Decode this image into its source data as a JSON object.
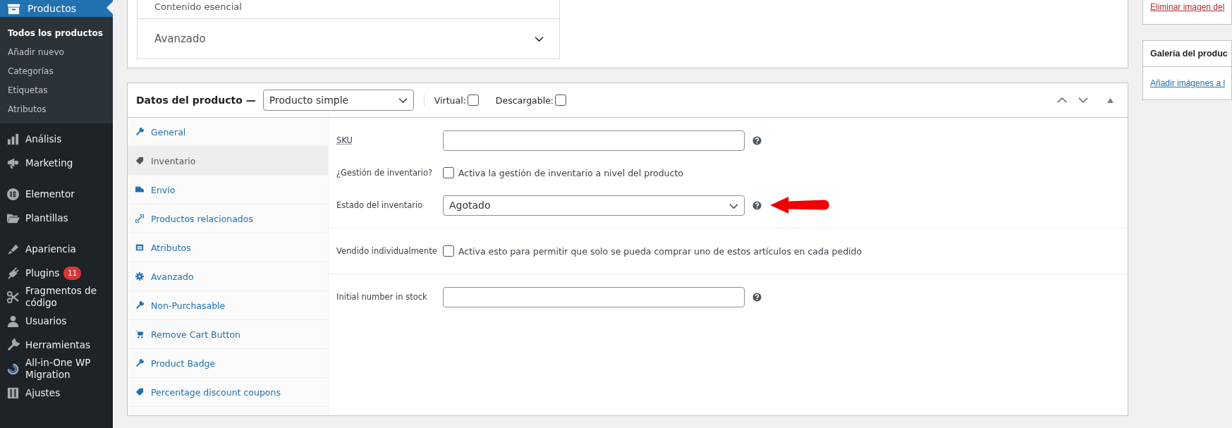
{
  "sidebar": {
    "current": {
      "label": "Productos",
      "submenu": [
        {
          "label": "Todos los productos",
          "selected": true
        },
        {
          "label": "Añadir nuevo",
          "selected": false
        },
        {
          "label": "Categorías",
          "selected": false
        },
        {
          "label": "Etiquetas",
          "selected": false
        },
        {
          "label": "Atributos",
          "selected": false
        }
      ]
    },
    "groups": [
      [
        {
          "label": "Análisis"
        },
        {
          "label": "Marketing"
        }
      ],
      [
        {
          "label": "Elementor"
        },
        {
          "label": "Plantillas"
        }
      ],
      [
        {
          "label": "Apariencia"
        },
        {
          "label": "Plugins",
          "badge": "11"
        },
        {
          "label": "Fragmentos de código"
        },
        {
          "label": "Usuarios"
        },
        {
          "label": "Herramientas"
        },
        {
          "label": "All-in-One WP Migration"
        },
        {
          "label": "Ajustes"
        }
      ]
    ]
  },
  "editor_panel": {
    "section_partial": "Contenido esencial",
    "section": "Avanzado"
  },
  "product_data": {
    "title": "Datos del producto —",
    "type_select": "Producto simple",
    "options": [
      {
        "label": "Virtual:",
        "checked": false
      },
      {
        "label": "Descargable:",
        "checked": false
      }
    ],
    "tabs": [
      {
        "label": "General",
        "selected": false
      },
      {
        "label": "Inventario",
        "selected": true
      },
      {
        "label": "Envío",
        "selected": false
      },
      {
        "label": "Productos relacionados",
        "selected": false
      },
      {
        "label": "Atributos",
        "selected": false
      },
      {
        "label": "Avanzado",
        "selected": false
      },
      {
        "label": "Non-Purchasable",
        "selected": false
      },
      {
        "label": "Remove Cart Button",
        "selected": false
      },
      {
        "label": "Product Badge",
        "selected": false
      },
      {
        "label": "Percentage discount coupons",
        "selected": false
      }
    ],
    "field_groups": [
      [
        {
          "kind": "text",
          "label": "SKU",
          "help": true
        },
        {
          "kind": "checkbox",
          "label": "¿Gestión de inventario?",
          "text": "Activa la gestión de inventario a nivel del producto",
          "checked": false
        },
        {
          "kind": "select",
          "label": "Estado del inventario",
          "value": "Agotado",
          "help": true
        }
      ],
      [
        {
          "kind": "checkbox",
          "label": "Vendido individualmente",
          "text": "Activa esto para permitir que solo se pueda comprar uno de estos artículos en cada pedido",
          "checked": false
        }
      ],
      [
        {
          "kind": "text",
          "label": "Initial number in stock",
          "help": true
        }
      ]
    ]
  },
  "side": {
    "remove_image_link": "Eliminar imagen del",
    "gallery_title": "Galería del produc",
    "gallery_link": "Añadir imágenes a l"
  }
}
